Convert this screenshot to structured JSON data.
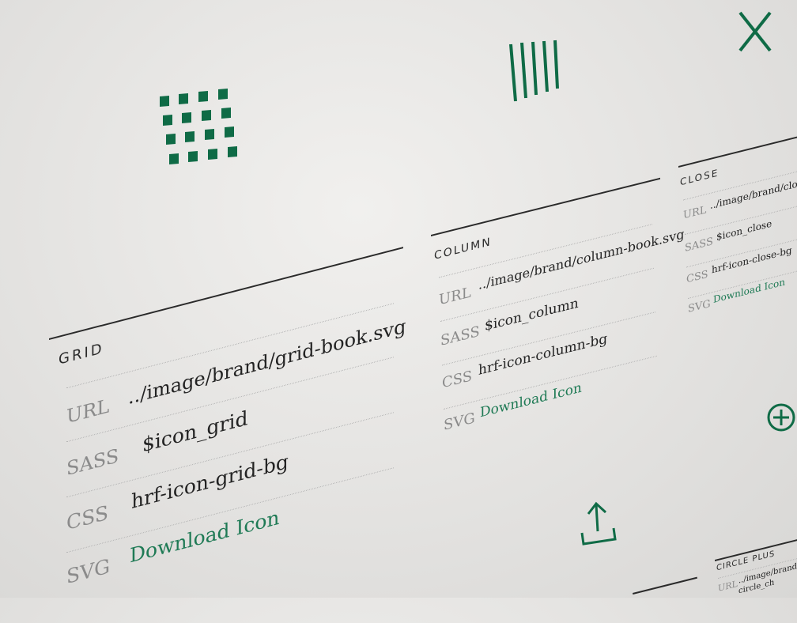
{
  "colors": {
    "accent": "#0f6b46",
    "text": "#232323",
    "muted": "#8b8b8b",
    "rule": "#2a2a2a"
  },
  "icons": [
    "close-icon",
    "grid-icon",
    "column-icon",
    "upload-icon",
    "circle-plus-icon"
  ],
  "cards": {
    "grid": {
      "title": "GRID",
      "url_label": "URL",
      "url_value": "../image/brand/grid-book.svg",
      "sass_label": "SASS",
      "sass_value": "$icon_grid",
      "css_label": "CSS",
      "css_value": "hrf-icon-grid-bg",
      "svg_label": "SVG",
      "svg_value": "Download Icon"
    },
    "column": {
      "title": "COLUMN",
      "url_label": "URL",
      "url_value": "../image/brand/column-book.svg",
      "sass_label": "SASS",
      "sass_value": "$icon_column",
      "css_label": "CSS",
      "css_value": "hrf-icon-column-bg",
      "svg_label": "SVG",
      "svg_value": "Download Icon"
    },
    "close": {
      "title": "CLOSE",
      "url_label": "URL",
      "url_value": "../image/brand/close-b",
      "sass_label": "SASS",
      "sass_value": "$icon_close",
      "css_label": "CSS",
      "css_value": "hrf-icon-close-bg",
      "svg_label": "SVG",
      "svg_value": "Download Icon"
    },
    "circle_plus": {
      "title": "CIRCLE PLUS",
      "url_label": "URL",
      "url_value": "../image/brand/ci",
      "extra_value": "circle_ch"
    }
  }
}
